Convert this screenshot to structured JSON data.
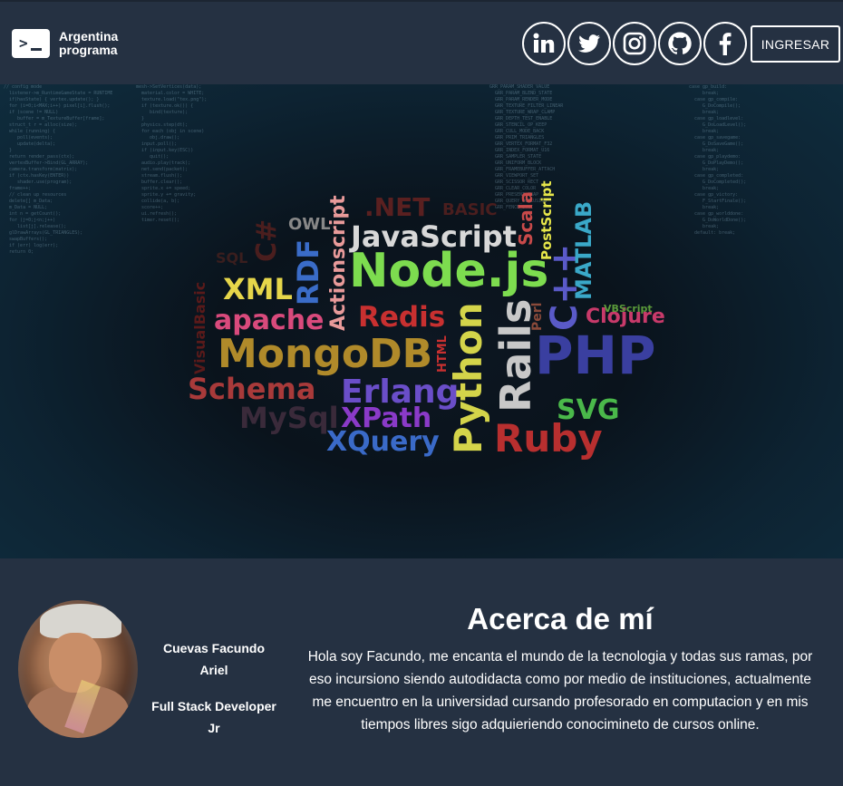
{
  "brand": {
    "line1": "Argentina",
    "line2": "programa",
    "icon": "terminal-icon"
  },
  "socials": [
    {
      "name": "linkedin-icon"
    },
    {
      "name": "twitter-icon"
    },
    {
      "name": "instagram-icon"
    },
    {
      "name": "github-icon"
    },
    {
      "name": "facebook-icon"
    }
  ],
  "login_label": "INGRESAR",
  "banner": {
    "words": [
      "Node.js",
      "JavaScript",
      "MongoDB",
      "PHP",
      "Python",
      "Rails",
      "Ruby",
      "XML",
      "RDF",
      "apache",
      "Redis",
      "Schema",
      "Erlang",
      "XPath",
      "XQuery",
      "MySql",
      "SVG",
      "Clojure",
      "C++",
      "MATLAB",
      "Actionscript",
      "PostScript",
      "Scala",
      "OWL",
      ".NET",
      "C#",
      "HTML",
      "VisualBasic",
      "Perl",
      "VBScript",
      "BASIC",
      "SQL"
    ]
  },
  "profile": {
    "name": "Cuevas Facundo Ariel",
    "role": "Full Stack Developer Jr"
  },
  "about": {
    "title": "Acerca de mí",
    "text": "Hola soy Facundo, me encanta el mundo de la tecnologia y todas sus ramas, por eso incursiono siendo autodidacta como por medio de instituciones, actualmente me encuentro en la universidad cursando profesorado en computacion y en mis tiempos libres sigo adquieriendo conocimineto de cursos online."
  },
  "colors": {
    "background": "#253142",
    "text": "#ffffff"
  }
}
